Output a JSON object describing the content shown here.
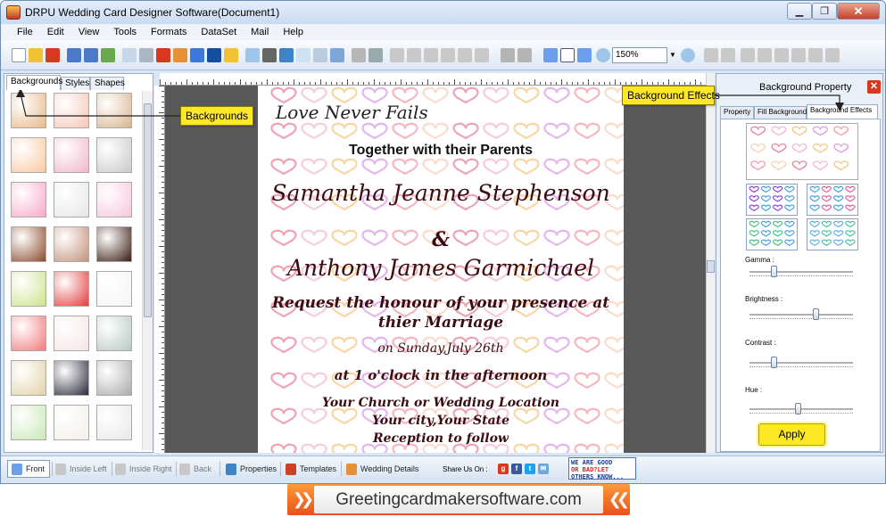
{
  "window": {
    "title": "DRPU Wedding Card Designer Software(Document1)"
  },
  "menu": [
    "File",
    "Edit",
    "View",
    "Tools",
    "Formats",
    "DataSet",
    "Mail",
    "Help"
  ],
  "toolbar": {
    "zoom_value": "150%"
  },
  "left_panel": {
    "tabs": [
      "Backgrounds",
      "Styles",
      "Shapes"
    ],
    "thumb_count": 21
  },
  "card": {
    "line1": "Love Never Fails",
    "line2": "Together with their Parents",
    "line3": "Samantha Jeanne Stephenson",
    "line4": "&",
    "line5": "Anthony James Garmichael",
    "line6": "Request the honour of your presence at",
    "line7": "thier Marriage",
    "line8": "on Sunday,July 26th",
    "line9": "at 1 o'clock in the afternoon",
    "line10": "Your Church or Wedding Location",
    "line11": "Your city,Your State",
    "line12": "Reception to follow",
    "colors": {
      "text": "#3a0c12",
      "accent": "#3a0c12"
    }
  },
  "right_panel": {
    "title": "Background Property",
    "tabs": [
      "Property",
      "Fill Background",
      "Background Effects"
    ],
    "sliders": [
      {
        "label": "Gamma :",
        "value": 0.22
      },
      {
        "label": "Brightness :",
        "value": 0.65
      },
      {
        "label": "Contrast :",
        "value": 0.22
      },
      {
        "label": "Hue :",
        "value": 0.47
      }
    ],
    "apply_label": "Apply"
  },
  "callouts": {
    "backgrounds": "Backgrounds",
    "effects": "Background Effects"
  },
  "statusbar": {
    "buttons": [
      "Front",
      "Inside Left",
      "Inside Right",
      "Back",
      "Properties",
      "Templates",
      "Wedding Details"
    ],
    "share_label": "Share Us On :",
    "feedback_line1": "WE ARE GOOD",
    "feedback_line2": "OR BAD?LET",
    "feedback_line3": "OTHERS KNOW..."
  },
  "banner": {
    "text": "Greetingcardmakersoftware.com"
  }
}
